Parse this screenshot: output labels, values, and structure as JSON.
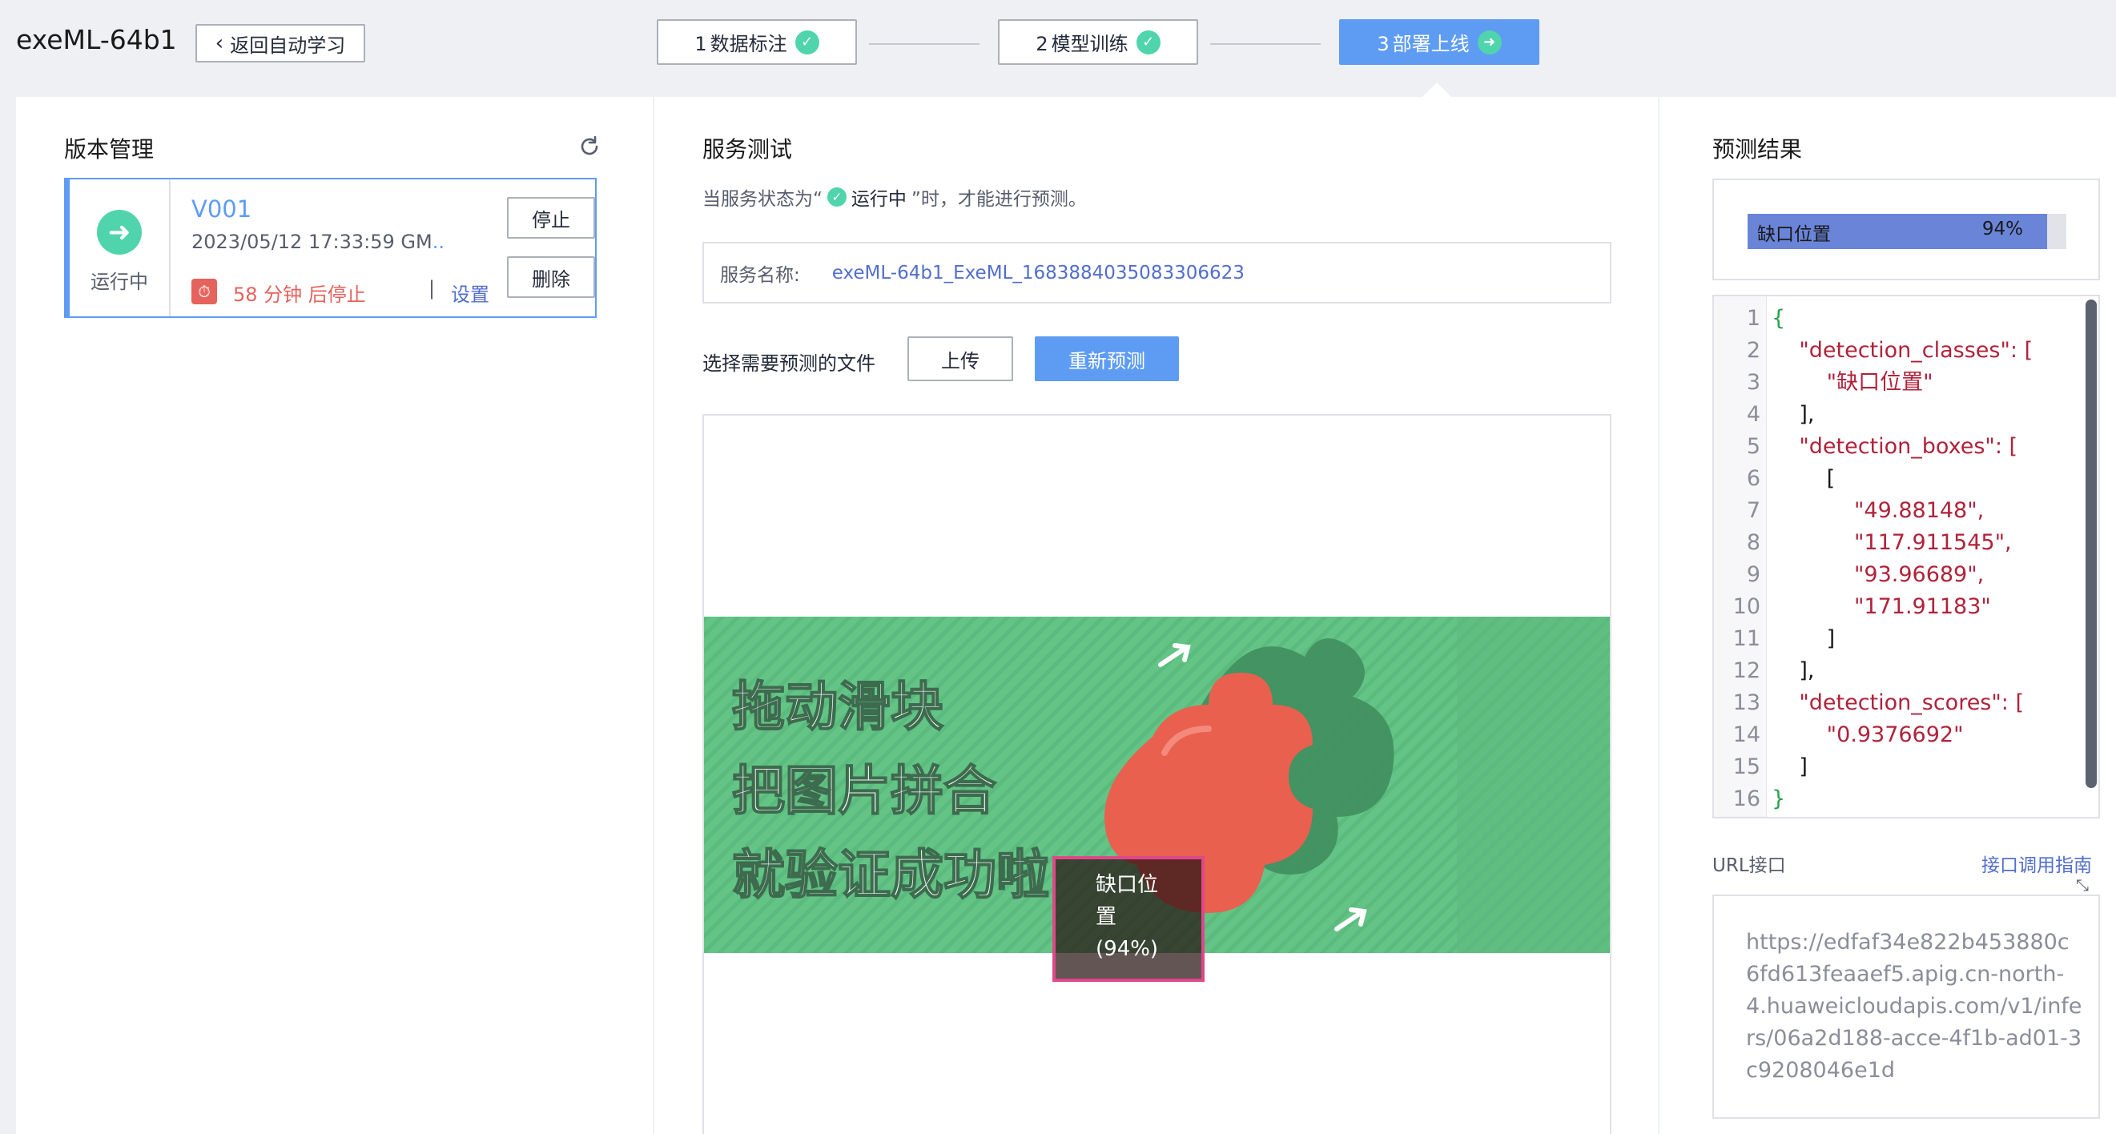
{
  "app": {
    "title": "exeML-64b1",
    "back_label": "返回自动学习"
  },
  "steps": [
    {
      "num": "1",
      "label": "数据标注",
      "state": "done"
    },
    {
      "num": "2",
      "label": "模型训练",
      "state": "done"
    },
    {
      "num": "3",
      "label": "部署上线",
      "state": "active"
    }
  ],
  "colors": {
    "primary": "#5e9cf4",
    "success": "#50d4ab",
    "danger": "#e5635d",
    "link": "#526ecc"
  },
  "version_panel": {
    "title": "版本管理",
    "refresh_icon": "refresh-icon",
    "card": {
      "status_icon": "arrow-right-circle-icon",
      "status_label": "运行中",
      "version": "V001",
      "time": "2023/05/12 17:33:59 GM",
      "time_ellipsis": "...",
      "timer_icon": "stopwatch-icon",
      "stop_text": "58 分钟 后停止",
      "separator": "|",
      "settings_label": "设置",
      "stop_button": "停止",
      "delete_button": "删除"
    }
  },
  "service_panel": {
    "title": "服务测试",
    "hint_prefix": "当服务状态为“",
    "hint_status": "运行中",
    "hint_suffix": "”时，才能进行预测。",
    "service_name_label": "服务名称:",
    "service_name_value": "exeML-64b1_ExeML_1683884035083306623",
    "choose_file_label": "选择需要预测的文件",
    "upload_button": "上传",
    "repredict_button": "重新预测",
    "image_text_lines": [
      "拖动滑块",
      "把图片拼合",
      "就验证成功啦"
    ],
    "detection": {
      "label_line1": "缺口位",
      "label_line2": "置",
      "label_line3": "(94%)"
    }
  },
  "result_panel": {
    "title": "预测结果",
    "bar": {
      "label": "缺口位置",
      "percent_text": "94%",
      "value": 0.94
    },
    "code_lines": [
      {
        "n": "1",
        "t": "{"
      },
      {
        "n": "2",
        "t": "    \"detection_classes\": ["
      },
      {
        "n": "3",
        "t": "        \"缺口位置\""
      },
      {
        "n": "4",
        "t": "    ],"
      },
      {
        "n": "5",
        "t": "    \"detection_boxes\": ["
      },
      {
        "n": "6",
        "t": "        ["
      },
      {
        "n": "7",
        "t": "            \"49.88148\","
      },
      {
        "n": "8",
        "t": "            \"117.911545\","
      },
      {
        "n": "9",
        "t": "            \"93.96689\","
      },
      {
        "n": "10",
        "t": "            \"171.91183\""
      },
      {
        "n": "11",
        "t": "        ]"
      },
      {
        "n": "12",
        "t": "    ],"
      },
      {
        "n": "13",
        "t": "    \"detection_scores\": ["
      },
      {
        "n": "14",
        "t": "        \"0.9376692\""
      },
      {
        "n": "15",
        "t": "    ]"
      },
      {
        "n": "16",
        "t": "}"
      }
    ],
    "url_label": "URL接口",
    "api_guide_link": "接口调用指南",
    "url_value": "https://edfaf34e822b453880c6fd613feaaef5.apig.cn-north-4.huaweicloudapis.com/v1/infers/06a2d188-acce-4f1b-ad01-3c9208046e1d"
  }
}
